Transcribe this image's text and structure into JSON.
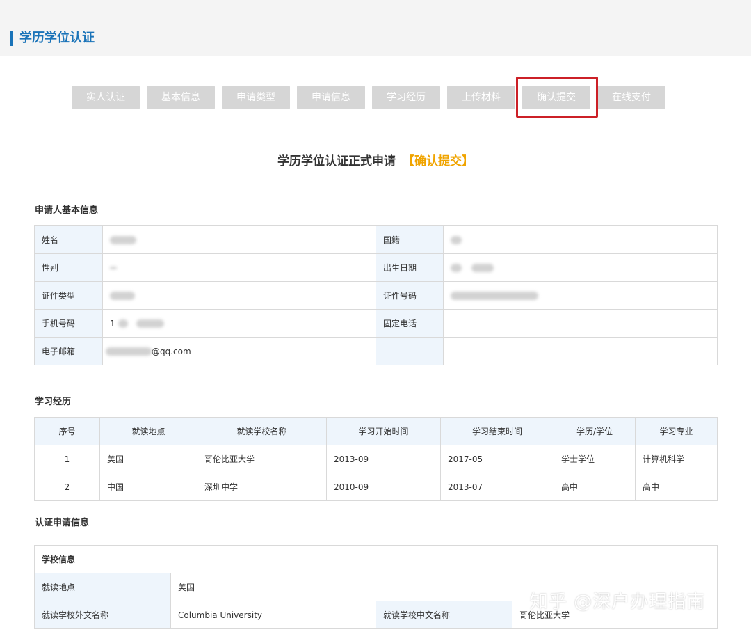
{
  "header": {
    "title": "学历学位认证"
  },
  "steps": [
    "实人认证",
    "基本信息",
    "申请类型",
    "申请信息",
    "学习经历",
    "上传材料",
    "确认提交",
    "在线支付"
  ],
  "page_title": {
    "main": "学历学位认证正式申请",
    "tag": "【确认提交】"
  },
  "applicant": {
    "section_title": "申请人基本信息",
    "labels": {
      "name": "姓名",
      "nationality": "国籍",
      "gender": "性别",
      "birth_date": "出生日期",
      "id_type": "证件类型",
      "id_number": "证件号码",
      "mobile": "手机号码",
      "landline": "固定电话",
      "email": "电子邮箱"
    },
    "values": {
      "mobile_prefix": "1",
      "email_suffix": "@qq.com"
    }
  },
  "education": {
    "section_title": "学习经历",
    "columns": [
      "序号",
      "就读地点",
      "就读学校名称",
      "学习开始时间",
      "学习结束时间",
      "学历/学位",
      "学习专业"
    ],
    "rows": [
      [
        "1",
        "美国",
        "哥伦比亚大学",
        "2013-09",
        "2017-05",
        "学士学位",
        "计算机科学"
      ],
      [
        "2",
        "中国",
        "深圳中学",
        "2010-09",
        "2013-07",
        "高中",
        "高中"
      ]
    ]
  },
  "certification": {
    "section_title": "认证申请信息",
    "school_info_title": "学校信息",
    "study_location_label": "就读地点",
    "study_location_value": "美国",
    "foreign_name_label": "就读学校外文名称",
    "foreign_name_value": "Columbia University",
    "chinese_name_label": "就读学校中文名称",
    "chinese_name_value": "哥伦比亚大学"
  },
  "watermark": "知乎 @深户办理指南"
}
